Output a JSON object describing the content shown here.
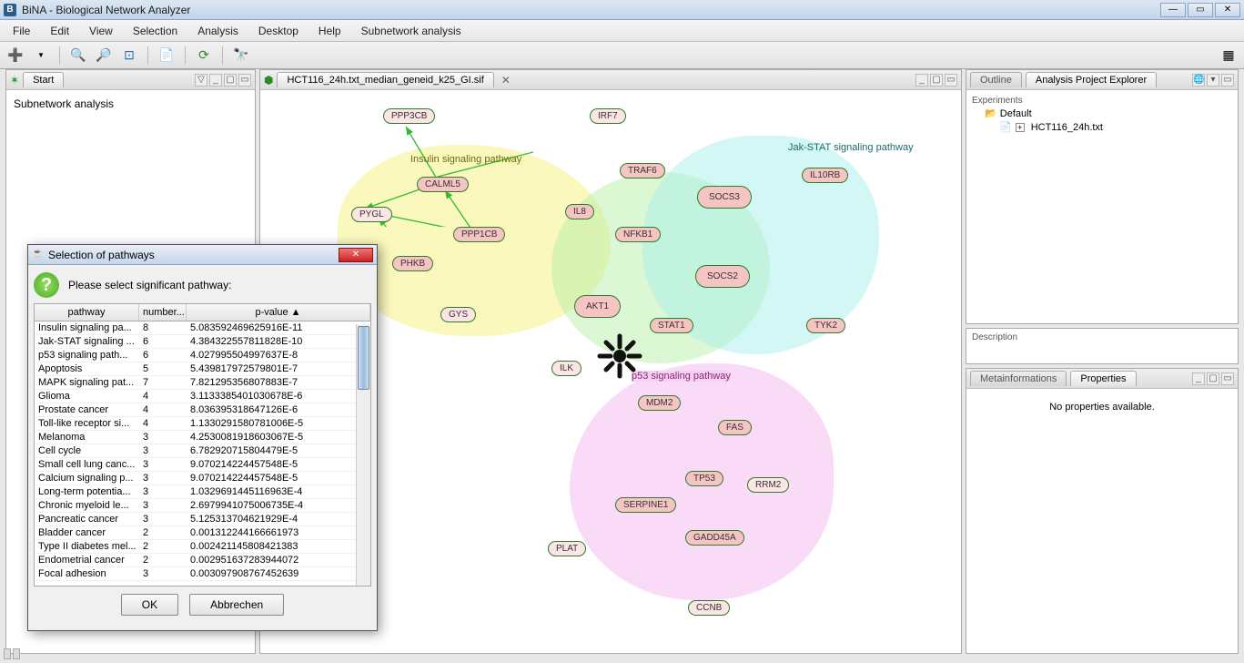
{
  "window": {
    "title": "BiNA - Biological Network Analyzer",
    "icon_letter": "B"
  },
  "menus": [
    "File",
    "Edit",
    "View",
    "Selection",
    "Analysis",
    "Desktop",
    "Help",
    "Subnetwork analysis"
  ],
  "left_panel": {
    "tab": "Start",
    "body_text": "Subnetwork analysis"
  },
  "center_panel": {
    "tab": "HCT116_24h.txt_median_geneid_k25_GI.sif",
    "pathway_labels": {
      "insulin": "Insulin signaling pathway",
      "jakstat": "Jak-STAT signaling pathway",
      "p53": "p53 signaling pathway"
    },
    "nodes": [
      "PPP3CB",
      "IRF7",
      "CALML5",
      "TRAF6",
      "PYGL",
      "PPP1CB",
      "IL8",
      "NFKB1",
      "SOCS3",
      "IL10RB",
      "PHKB",
      "AKT1",
      "SOCS2",
      "GYS",
      "STAT1",
      "TYK2",
      "ILK",
      "MDM2",
      "FAS",
      "SERPINE1",
      "TP53",
      "RRM2",
      "PLAT",
      "GADD45A",
      "CCNB"
    ]
  },
  "right": {
    "tab_outline": "Outline",
    "tab_explorer": "Analysis Project Explorer",
    "section_label": "Experiments",
    "folder": "Default",
    "file": "HCT116_24h.txt",
    "desc_label": "Description",
    "tab_meta": "Metainformations",
    "tab_props": "Properties",
    "props_empty": "No properties available."
  },
  "dialog": {
    "title": "Selection of pathways",
    "prompt": "Please select significant pathway:",
    "columns": {
      "c1": "pathway",
      "c2": "number...",
      "c3": "p-value"
    },
    "sort_indicator": "▲",
    "rows": [
      {
        "p": "Insulin signaling pa...",
        "n": "8",
        "v": "5.083592469625916E-11"
      },
      {
        "p": "Jak-STAT signaling ...",
        "n": "6",
        "v": "4.384322557811828E-10"
      },
      {
        "p": "p53 signaling path...",
        "n": "6",
        "v": "4.027995504997637E-8"
      },
      {
        "p": "Apoptosis",
        "n": "5",
        "v": "5.43981797257980​1E-7"
      },
      {
        "p": "MAPK signaling pat...",
        "n": "7",
        "v": "7.821295356807883E-7"
      },
      {
        "p": "Glioma",
        "n": "4",
        "v": "3.113338540103067​8E-6"
      },
      {
        "p": "Prostate cancer",
        "n": "4",
        "v": "8.036395318647126E-6"
      },
      {
        "p": "Toll-like receptor si...",
        "n": "4",
        "v": "1.133029158078100​6E-5"
      },
      {
        "p": "Melanoma",
        "n": "3",
        "v": "4.253008191860306​7E-5"
      },
      {
        "p": "Cell cycle",
        "n": "3",
        "v": "6.782920715804479E-5"
      },
      {
        "p": "Small cell lung canc...",
        "n": "3",
        "v": "9.070214224457548E-5"
      },
      {
        "p": "Calcium signaling p...",
        "n": "3",
        "v": "9.070214224457548E-5"
      },
      {
        "p": "Long-term potentia...",
        "n": "3",
        "v": "1.032969144511696​3E-4"
      },
      {
        "p": "Chronic myeloid le...",
        "n": "3",
        "v": "2.697994107500673​5E-4"
      },
      {
        "p": "Pancreatic cancer",
        "n": "3",
        "v": "5.125313704621929E-4"
      },
      {
        "p": "Bladder cancer",
        "n": "2",
        "v": "0.001312244166661​973"
      },
      {
        "p": "Type II diabetes mel...",
        "n": "2",
        "v": "0.002421145808421​383"
      },
      {
        "p": "Endometrial cancer",
        "n": "2",
        "v": "0.002951637283944​072"
      },
      {
        "p": "Focal adhesion",
        "n": "3",
        "v": "0.003097908767452​639"
      }
    ],
    "ok": "OK",
    "cancel": "Abbrechen"
  }
}
